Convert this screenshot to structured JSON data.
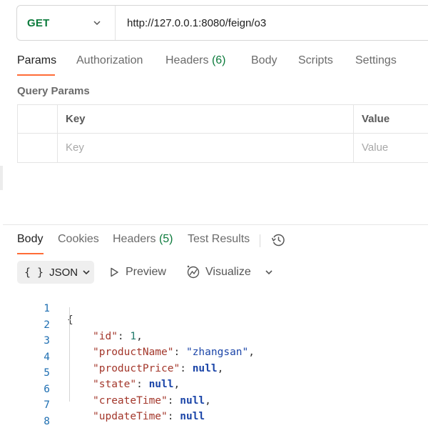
{
  "request": {
    "method": "GET",
    "url": "http://127.0.0.1:8080/feign/o3"
  },
  "request_tabs": [
    {
      "label": "Params",
      "active": true
    },
    {
      "label": "Authorization"
    },
    {
      "label": "Headers",
      "count": "(6)"
    },
    {
      "label": "Body"
    },
    {
      "label": "Scripts"
    },
    {
      "label": "Settings"
    }
  ],
  "query_params": {
    "title": "Query Params",
    "headers": {
      "key": "Key",
      "value": "Value"
    },
    "placeholder": {
      "key": "Key",
      "value": "Value"
    }
  },
  "response_tabs": [
    {
      "label": "Body",
      "active": true
    },
    {
      "label": "Cookies"
    },
    {
      "label": "Headers",
      "count": "(5)"
    },
    {
      "label": "Test Results"
    }
  ],
  "response_toolbar": {
    "format_icon": "{ }",
    "format": "JSON",
    "preview": "Preview",
    "visualize": "Visualize"
  },
  "response_body": {
    "line_numbers": [
      "1",
      "2",
      "3",
      "4",
      "5",
      "6",
      "7",
      "8"
    ],
    "fields": [
      {
        "key": "\"id\"",
        "value": "1",
        "type": "number"
      },
      {
        "key": "\"productName\"",
        "value": "\"zhangsan\"",
        "type": "string"
      },
      {
        "key": "\"productPrice\"",
        "value": "null",
        "type": "null"
      },
      {
        "key": "\"state\"",
        "value": "null",
        "type": "null"
      },
      {
        "key": "\"createTime\"",
        "value": "null",
        "type": "null"
      },
      {
        "key": "\"updateTime\"",
        "value": "null",
        "type": "null"
      }
    ]
  },
  "colors": {
    "accent": "#ff6c37",
    "method_get": "#0b7a3b",
    "json_key": "#a3372b",
    "json_string": "#1b45a8",
    "json_number": "#1f7a6a"
  }
}
